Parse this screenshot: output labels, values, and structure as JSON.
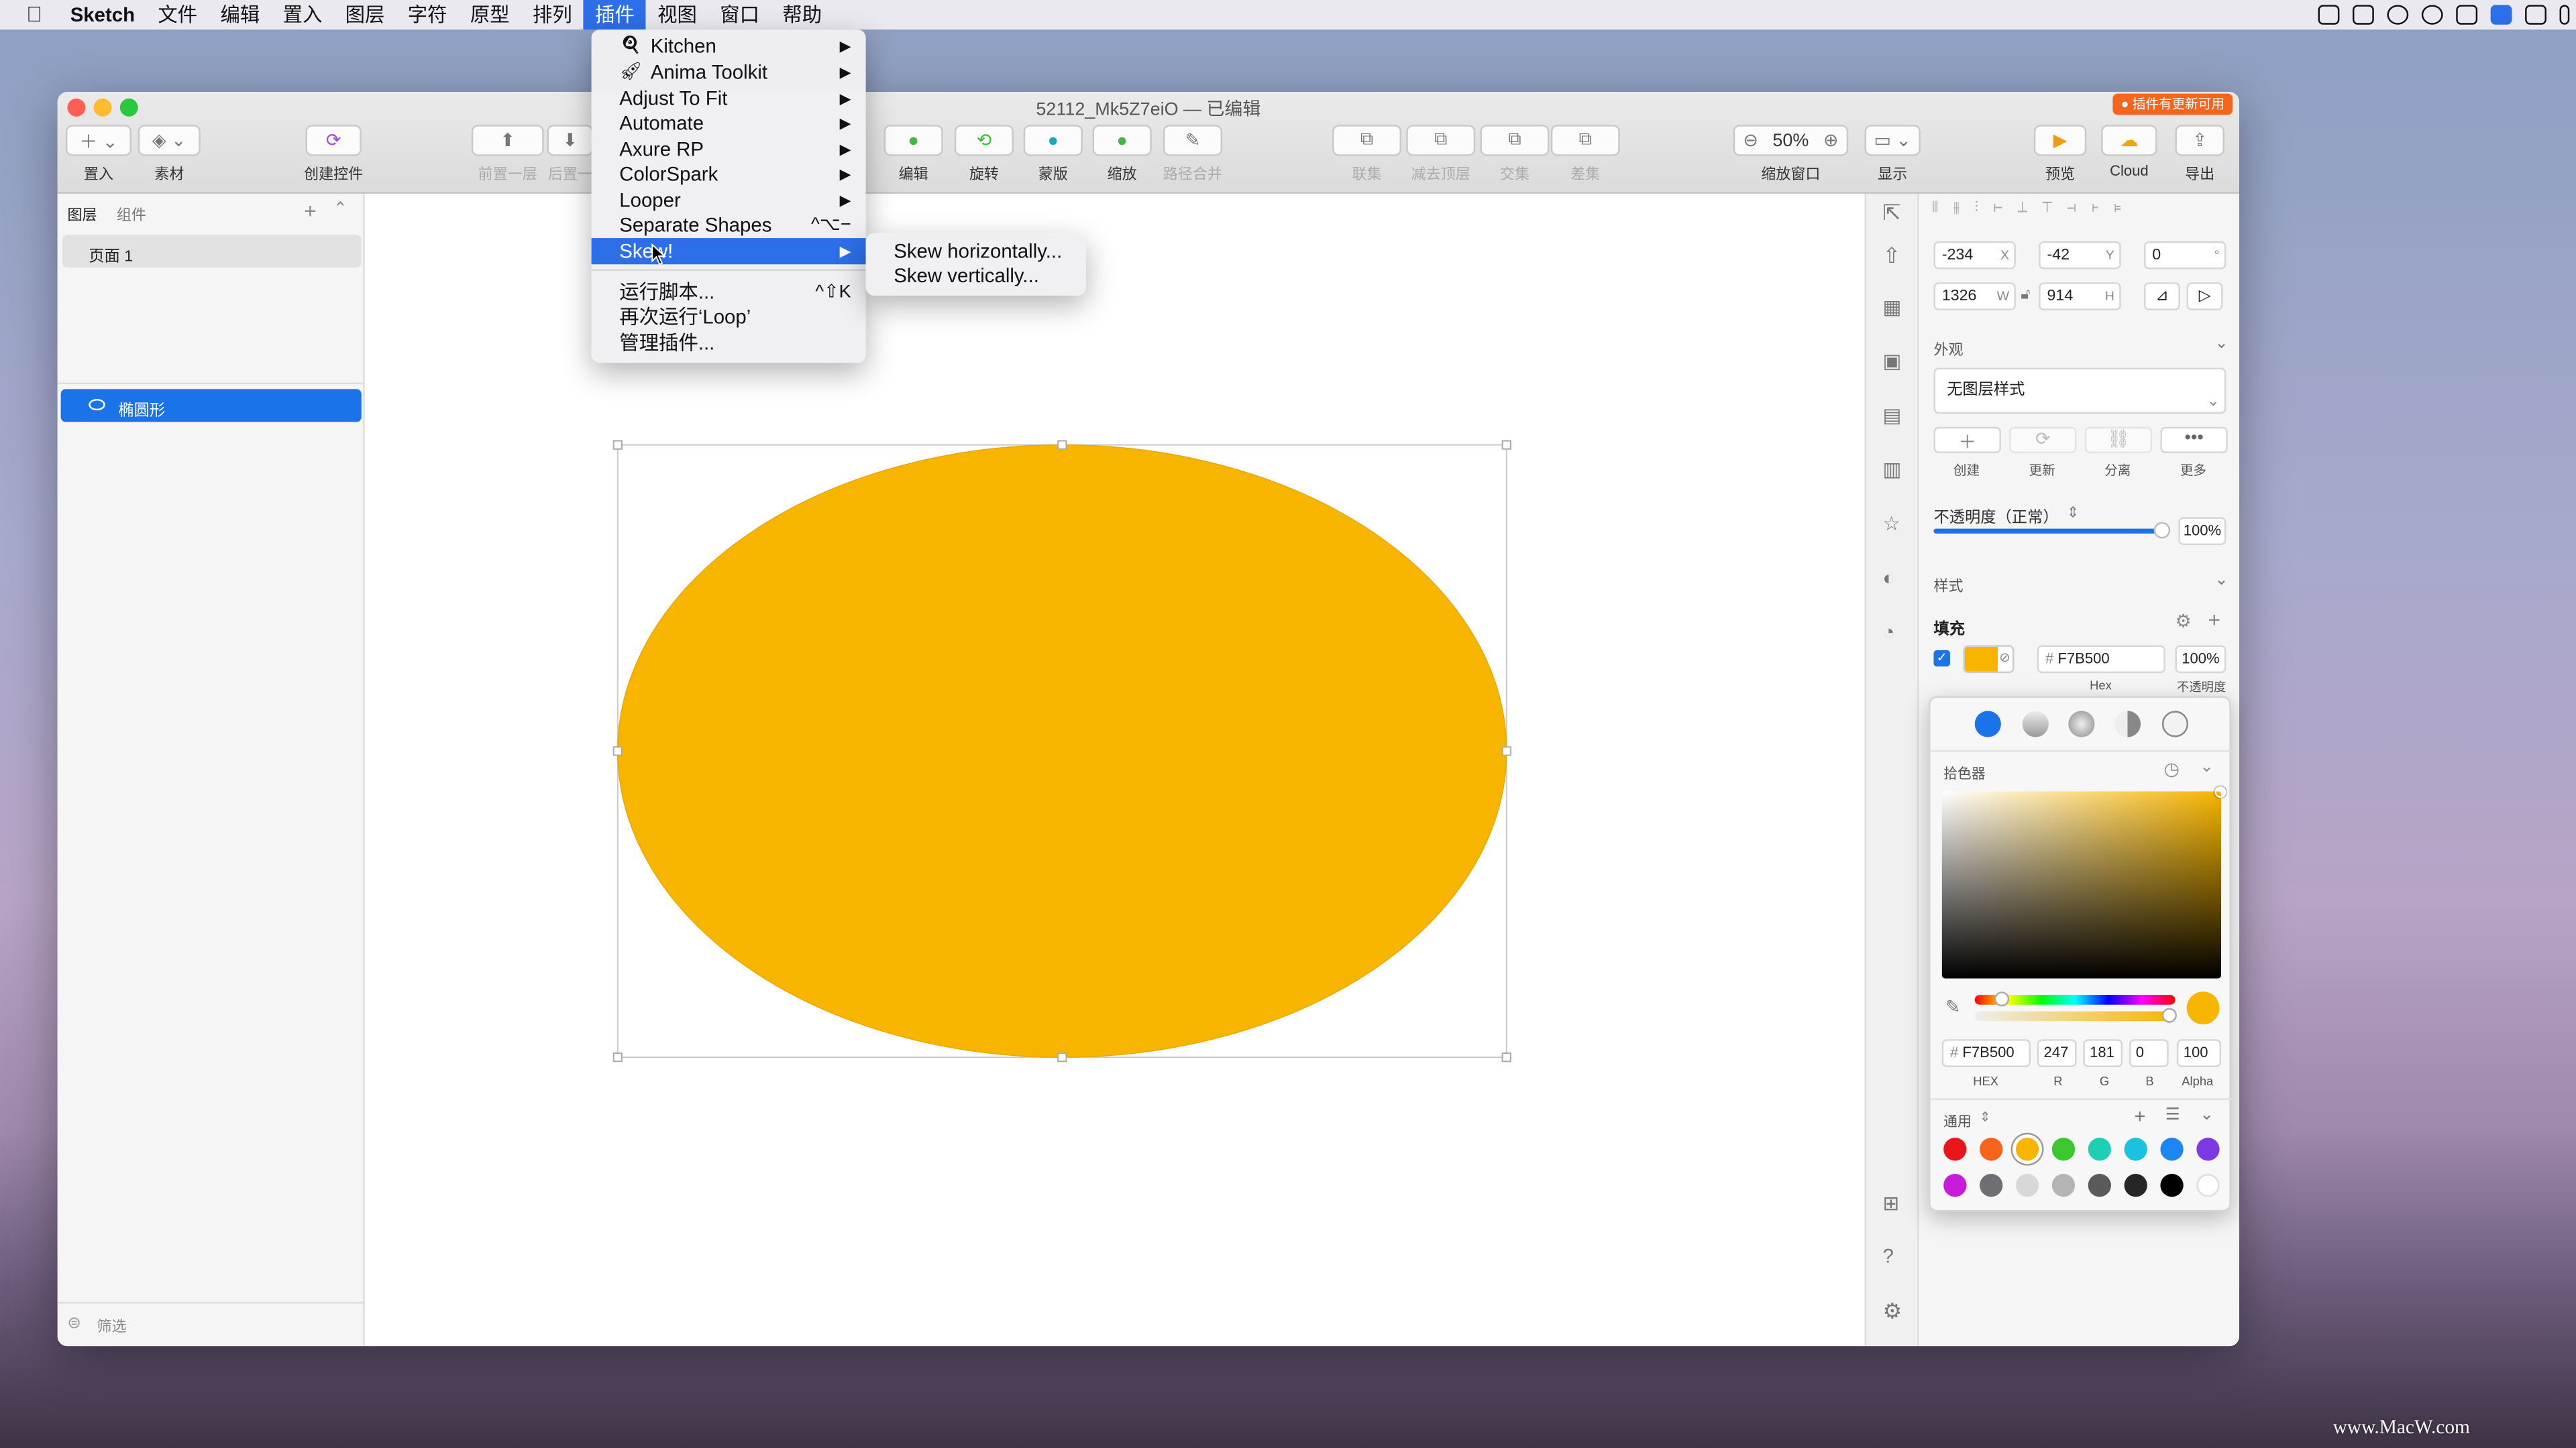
{
  "menubar": {
    "app": "Sketch",
    "items": [
      "文件",
      "编辑",
      "置入",
      "图层",
      "字符",
      "原型",
      "排列",
      "插件",
      "视图",
      "窗口",
      "帮助"
    ],
    "active": "插件"
  },
  "window": {
    "title": "52112_Mk5Z7eiO — 已编辑",
    "update_badge": "● 插件有更新可用"
  },
  "toolbar": {
    "insert": "置入",
    "assets": "素材",
    "create_symbol": "创建控件",
    "forward": "前置一层",
    "backward": "后置一",
    "edit": "编辑",
    "rotate": "旋转",
    "mask": "蒙版",
    "scale": "缩放",
    "flatten": "路径合并",
    "union": "联集",
    "subtract": "减去顶层",
    "intersect": "交集",
    "difference": "差集",
    "zoom_value": "50%",
    "zoom_label": "缩放窗口",
    "view": "显示",
    "preview": "预览",
    "cloud": "Cloud",
    "export": "导出"
  },
  "sidebar": {
    "tab_layers": "图层",
    "tab_components": "组件",
    "page": "页面 1",
    "layer": "椭圆形",
    "filter": "筛选"
  },
  "inspector": {
    "x": "-234",
    "x_label": "X",
    "y": "-42",
    "y_label": "Y",
    "rotation": "0",
    "rotation_unit": "°",
    "w": "1326",
    "w_label": "W",
    "h": "914",
    "h_label": "H",
    "appearance": "外观",
    "style_select": "无图层样式",
    "style_actions": [
      "创建",
      "更新",
      "分离",
      "更多"
    ],
    "opacity_label": "不透明度（正常）",
    "opacity_value": "100%",
    "opacity_fraction": 1.0,
    "style_section": "样式",
    "fill_section": "填充",
    "fill_hex": "F7B500",
    "fill_opacity": "100%",
    "hex_label": "Hex",
    "opacity_col_label": "不透明度"
  },
  "color_picker": {
    "title": "拾色器",
    "hex": "F7B500",
    "hex_label": "HEX",
    "r": "247",
    "g": "181",
    "b": "0",
    "alpha": "100",
    "r_label": "R",
    "g_label": "G",
    "b_label": "B",
    "alpha_label": "Alpha",
    "presets_label": "通用",
    "preset_colors": [
      "#e8161b",
      "#f7631a",
      "#f7b500",
      "#3cc62f",
      "#1ed0b3",
      "#19c2e0",
      "#1d86f2",
      "#7d38e6",
      "#c61bd9",
      "#6e6f73",
      "#d8d8d8",
      "#b4b4b4",
      "#5a5a5a",
      "#262626",
      "#000000",
      "#ffffff"
    ]
  },
  "shape": {
    "fill": "#F7B500",
    "stroke": "#E8A800"
  },
  "plugins_menu": {
    "items": [
      {
        "label": "Kitchen",
        "arrow": "▶"
      },
      {
        "label": "Anima Toolkit",
        "arrow": "▶"
      },
      {
        "label": "Adjust To Fit",
        "arrow": "▶"
      },
      {
        "label": "Automate",
        "arrow": "▶"
      },
      {
        "label": "Axure RP",
        "arrow": "▶"
      },
      {
        "label": "ColorSpark",
        "arrow": "▶"
      },
      {
        "label": "Looper",
        "arrow": "▶"
      },
      {
        "label": "Separate Shapes",
        "shortcut": "^⌥−"
      },
      {
        "label": "Skew!",
        "arrow": "▶"
      }
    ],
    "run_script": "运行脚本...",
    "run_script_shortcut": "^⇧K",
    "rerun": "再次运行‘Loop’",
    "manage": "管理插件..."
  },
  "skew_submenu": {
    "items": [
      "Skew horizontally...",
      "Skew vertically..."
    ]
  },
  "watermark": "www.MacW.com"
}
